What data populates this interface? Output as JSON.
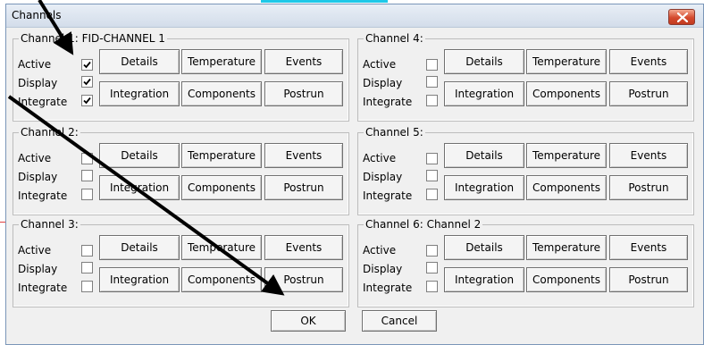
{
  "window": {
    "title": "Channels"
  },
  "row_labels": {
    "active": "Active",
    "display": "Display",
    "integrate": "Integrate"
  },
  "buttons": {
    "details": "Details",
    "temperature": "Temperature",
    "events": "Events",
    "integration": "Integration",
    "components": "Components",
    "postrun": "Postrun"
  },
  "channels": [
    {
      "legend": "Channel 1: FID-CHANNEL 1",
      "active": true,
      "display": true,
      "integrate": true
    },
    {
      "legend": "Channel 2:",
      "active": false,
      "display": false,
      "integrate": false
    },
    {
      "legend": "Channel 3:",
      "active": false,
      "display": false,
      "integrate": false
    },
    {
      "legend": "Channel 4:",
      "active": false,
      "display": false,
      "integrate": false
    },
    {
      "legend": "Channel 5:",
      "active": false,
      "display": false,
      "integrate": false
    },
    {
      "legend": "Channel 6: Channel 2",
      "active": false,
      "display": false,
      "integrate": false
    }
  ],
  "footer": {
    "ok": "OK",
    "cancel": "Cancel"
  },
  "colors": {
    "close_button": "#d44a2e",
    "dialog_bg": "#f0f0f0",
    "annotation_arrow": "#000000"
  },
  "icons": {
    "close": "close-x-icon",
    "check": "checkmark-icon"
  }
}
